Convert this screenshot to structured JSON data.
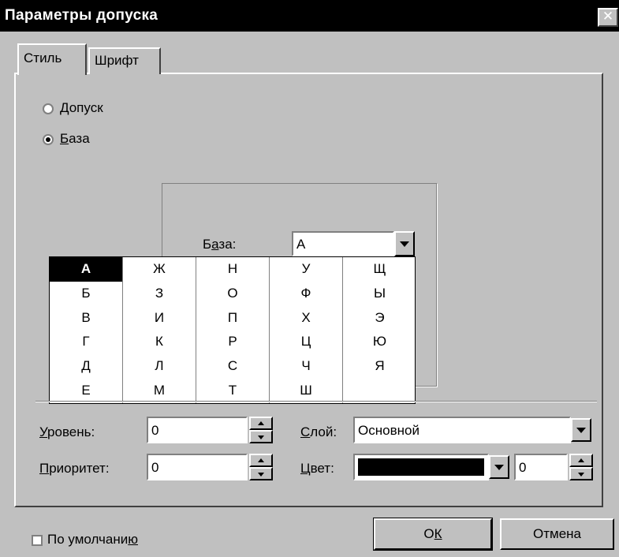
{
  "dialog": {
    "title": "Параметры допуска",
    "close_glyph": "✕"
  },
  "tabs": [
    {
      "label": "Стиль",
      "active": true
    },
    {
      "label": "Шрифт",
      "active": false
    }
  ],
  "type_radio": {
    "options": [
      {
        "label": "Допуск",
        "mnemonic": "Д",
        "rest": "опуск",
        "checked": false
      },
      {
        "label": "База",
        "mnemonic": "Б",
        "rest": "аза",
        "checked": true
      }
    ]
  },
  "base_field": {
    "label_pre": "Б",
    "label_mnemonic": "а",
    "label_post": "за:",
    "value": "А"
  },
  "base_dropdown": {
    "columns": [
      [
        "А",
        "Б",
        "В",
        "Г",
        "Д",
        "Е"
      ],
      [
        "Ж",
        "З",
        "И",
        "К",
        "Л",
        "М"
      ],
      [
        "Н",
        "О",
        "П",
        "Р",
        "С",
        "Т"
      ],
      [
        "У",
        "Ф",
        "Х",
        "Ц",
        "Ч",
        "Ш"
      ],
      [
        "Щ",
        "Ы",
        "Э",
        "Ю",
        "Я",
        ""
      ]
    ],
    "selected": "А"
  },
  "level": {
    "label_mnemonic": "У",
    "label_rest": "ровень:",
    "value": "0"
  },
  "priority": {
    "label_mnemonic": "П",
    "label_rest": "риоритет:",
    "value": "0"
  },
  "layer": {
    "label_mnemonic": "С",
    "label_rest": "лой:",
    "value": "Основной"
  },
  "color": {
    "label_mnemonic": "Ц",
    "label_rest": "вет:",
    "swatch": "#000000",
    "index_value": "0"
  },
  "default_checkbox": {
    "label_pre": "По умолчани",
    "label_mnemonic": "ю",
    "checked": false
  },
  "buttons": {
    "ok": {
      "pre": "О",
      "mnemonic": "К"
    },
    "cancel": "Отмена"
  }
}
